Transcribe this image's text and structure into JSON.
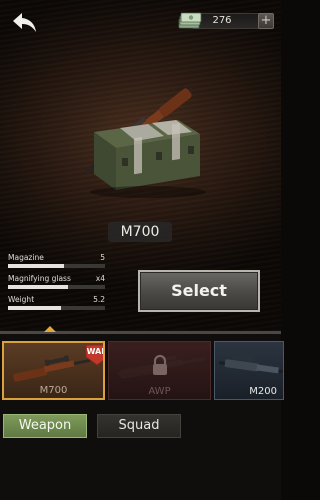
{
  "header": {
    "back_icon": "back-arrow-icon",
    "currency": {
      "icon": "cash-stack-icon",
      "value": "276",
      "add_label": "+"
    }
  },
  "showcase": {
    "weapon_name": "M700",
    "item_icon": "weapon-crate-icon"
  },
  "stats": [
    {
      "label": "Magazine",
      "value": "5",
      "level": 0.58
    },
    {
      "label": "Magnifying glass",
      "value": "x4",
      "level": 0.62
    },
    {
      "label": "Weight",
      "value": "5.2",
      "level": 0.55
    }
  ],
  "actions": {
    "select_label": "Select"
  },
  "weapons": [
    {
      "name": "M700",
      "state": "selected",
      "badge": "WAR"
    },
    {
      "name": "AWP",
      "state": "locked",
      "icon": "padlock-icon"
    },
    {
      "name": "M200",
      "state": "available"
    }
  ],
  "tabs": [
    {
      "label": "Weapon",
      "active": true
    },
    {
      "label": "Squad",
      "active": false
    }
  ],
  "colors": {
    "accent_gold": "#d9a23d",
    "tab_active": "#6f8a4f",
    "badge_red": "#c0392b"
  }
}
